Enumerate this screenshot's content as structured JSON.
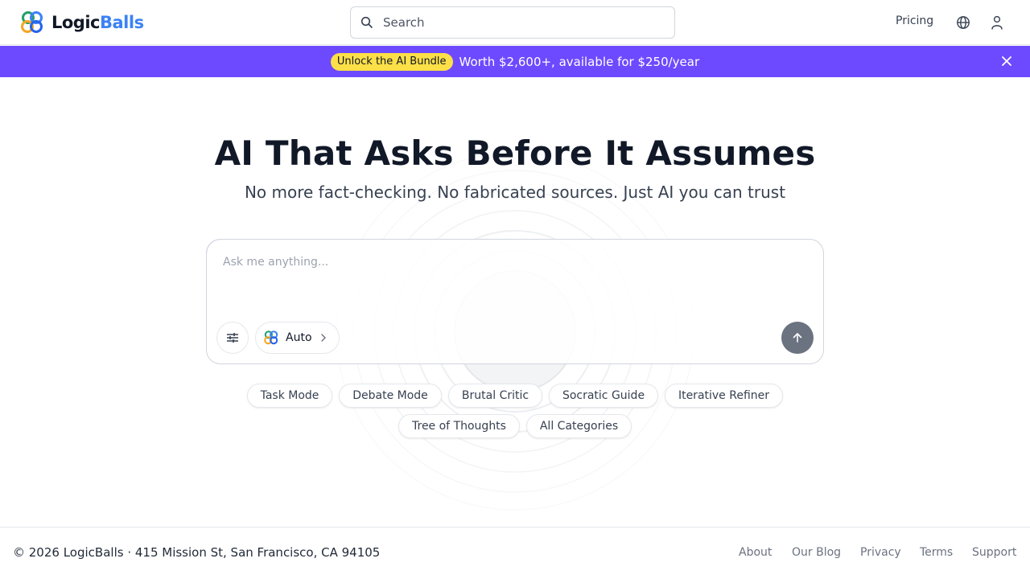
{
  "header": {
    "brand_part1": "Logic",
    "brand_part2": "Balls",
    "search_placeholder": "Search",
    "pricing_label": "Pricing",
    "icons": [
      "logo-icon",
      "search-icon",
      "globe-icon",
      "user-icon"
    ]
  },
  "banner": {
    "badge": "Unlock the AI Bundle",
    "text": "Worth $2,600+, available for $250/year",
    "background": "#6d4aff",
    "badge_color": "#fde047"
  },
  "hero": {
    "title": "AI That Asks Before It Assumes",
    "subtitle": "No more fact-checking. No fabricated sources. Just AI you can trust"
  },
  "prompt": {
    "placeholder": "Ask me anything...",
    "model_label": "Auto"
  },
  "chips": [
    "Task Mode",
    "Debate Mode",
    "Brutal Critic",
    "Socratic Guide",
    "Iterative Refiner",
    "Tree of Thoughts",
    "All Categories"
  ],
  "footer": {
    "copyright": "© 2026 LogicBalls · 415 Mission St, San Francisco, CA 94105",
    "links": [
      "About",
      "Our Blog",
      "Privacy",
      "Terms",
      "Support"
    ]
  }
}
